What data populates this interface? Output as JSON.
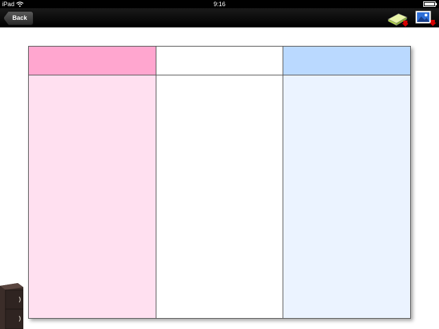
{
  "status_bar": {
    "device": "iPad",
    "time": "9:16"
  },
  "toolbar": {
    "back_label": "Back",
    "icons": [
      "eraser-clear-icon",
      "save-image-icon"
    ]
  },
  "board": {
    "columns": [
      {
        "header_color": "#ffa6cf",
        "body_color": "#ffe0f0"
      },
      {
        "header_color": "#ffffff",
        "body_color": "#ffffff"
      },
      {
        "header_color": "#bad9ff",
        "body_color": "#ebf3ff"
      }
    ]
  },
  "colors": {
    "toolbar": "#000000",
    "border": "#555555"
  }
}
